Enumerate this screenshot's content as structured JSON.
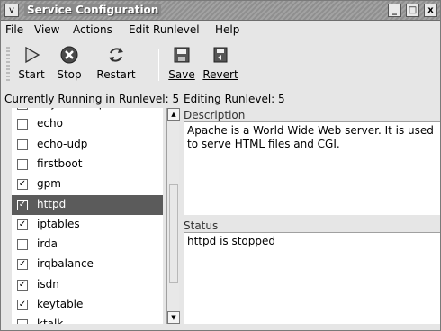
{
  "window": {
    "title": "Service Configuration",
    "menu_glyph": "v",
    "minimize_glyph": "_",
    "maximize_glyph": "□",
    "close_glyph": "x"
  },
  "menubar": {
    "items": [
      "File",
      "View",
      "Actions",
      "Edit Runlevel",
      "Help"
    ]
  },
  "toolbar": {
    "start_label": "Start",
    "stop_label": "Stop",
    "restart_label": "Restart",
    "save_label": "Save",
    "revert_label": "Revert"
  },
  "status": {
    "running": "Currently Running in Runlevel: 5",
    "editing": "Editing Runlevel: 5"
  },
  "services": [
    {
      "name": "daytime-udp",
      "checked": false,
      "selected": false
    },
    {
      "name": "echo",
      "checked": false,
      "selected": false
    },
    {
      "name": "echo-udp",
      "checked": false,
      "selected": false
    },
    {
      "name": "firstboot",
      "checked": false,
      "selected": false
    },
    {
      "name": "gpm",
      "checked": true,
      "selected": false
    },
    {
      "name": "httpd",
      "checked": true,
      "selected": true
    },
    {
      "name": "iptables",
      "checked": true,
      "selected": false
    },
    {
      "name": "irda",
      "checked": false,
      "selected": false
    },
    {
      "name": "irqbalance",
      "checked": true,
      "selected": false
    },
    {
      "name": "isdn",
      "checked": true,
      "selected": false
    },
    {
      "name": "keytable",
      "checked": true,
      "selected": false
    },
    {
      "name": "ktalk",
      "checked": false,
      "selected": false
    }
  ],
  "description": {
    "title": "Description",
    "text": "Apache is a World Wide Web server.  It is used to serve HTML files and CGI."
  },
  "status_pane": {
    "title": "Status",
    "text": "httpd is stopped"
  },
  "colors": {
    "selection": "#5b5b5b",
    "titlebar": "#8f8f8f"
  }
}
